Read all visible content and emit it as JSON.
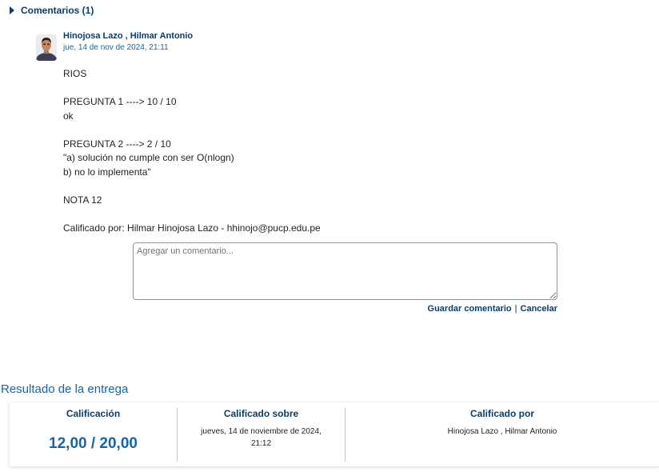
{
  "comments": {
    "toggle_label": "Comentarios (1)",
    "author": "Hinojosa Lazo , Hilmar Antonio",
    "timestamp": "jue, 14 de nov de 2024, 21:11",
    "body_lines": [
      "RIOS",
      "",
      "PREGUNTA 1 ----> 10 / 10",
      "ok",
      "",
      "PREGUNTA 2 ----> 2 / 10",
      "\"a) solución no cumple con ser O(nlogn)",
      "b) no lo implementa\"",
      "",
      "NOTA 12",
      "",
      "Calificado por: Hilmar Hinojosa Lazo - hhinojo@pucp.edu.pe"
    ],
    "input_placeholder": "Agregar un comentario...",
    "save_label": "Guardar comentario",
    "separator": "|",
    "cancel_label": "Cancelar"
  },
  "result": {
    "section_title": "Resultado de la entrega",
    "grade_label": "Calificación",
    "grade_value": "12,00 / 20,00",
    "graded_on_label": "Calificado sobre",
    "graded_on_value": "jueves, 14 de noviembre de 2024, 21:12",
    "graded_by_label": "Calificado por",
    "graded_by_value": "Hinojosa Lazo , Hilmar Antonio"
  },
  "icons": {
    "toggle": "caret-right-icon",
    "avatar": "user-photo"
  },
  "colors": {
    "primary": "#0a3d6b",
    "accent": "#1565a8",
    "divider": "#a8cce8"
  }
}
